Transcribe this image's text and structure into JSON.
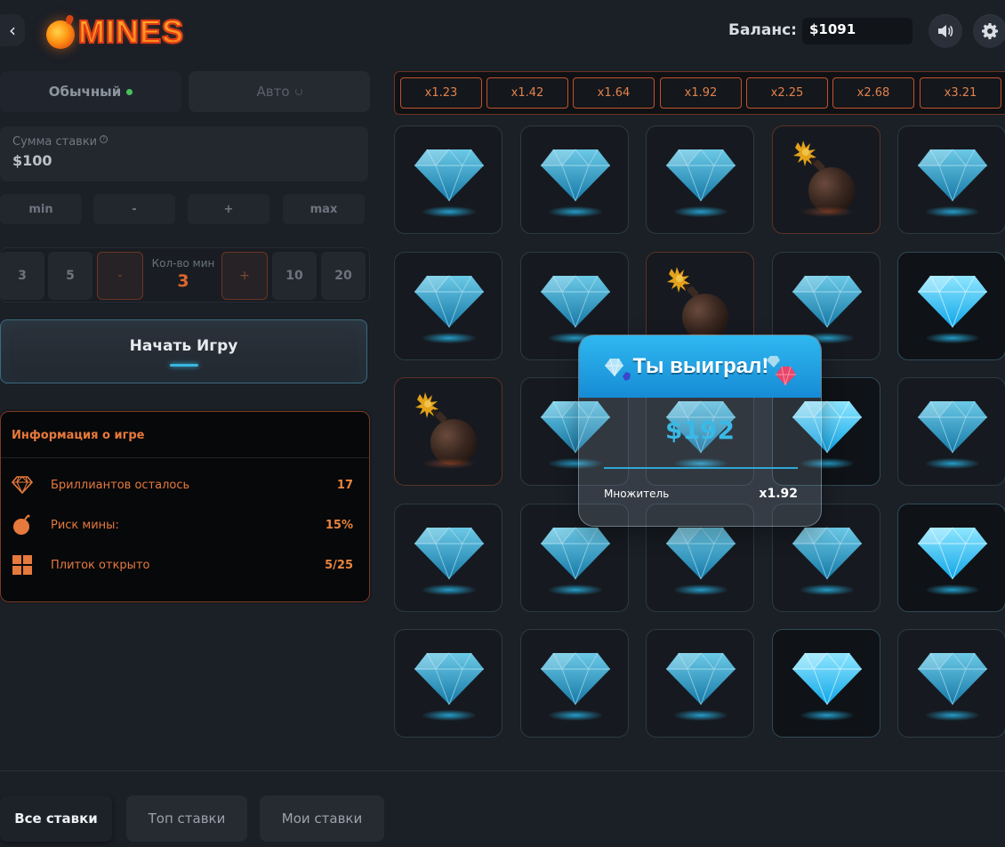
{
  "header": {
    "logo_text": "MINES",
    "balance_label": "Баланс:",
    "balance_value": "$1091"
  },
  "mode_tabs": [
    {
      "label": "Обычный",
      "active": true
    },
    {
      "label": "Авто",
      "active": false
    }
  ],
  "bet": {
    "label": "Сумма ставки",
    "value": "$100",
    "controls": [
      "min",
      "-",
      "+",
      "max"
    ]
  },
  "mines": {
    "options_left": [
      "3",
      "5"
    ],
    "decrement": "-",
    "count_label": "Кол-во мин",
    "count_value": "3",
    "increment": "+",
    "options_right": [
      "10",
      "20"
    ]
  },
  "start_button": {
    "label": "Начать Игру"
  },
  "info": {
    "title": "Информация о игре",
    "rows": [
      {
        "icon": "diamond-icon",
        "label": "Бриллиантов осталось",
        "value": "17"
      },
      {
        "icon": "bomb-icon",
        "label": "Риск мины:",
        "value": "15%"
      },
      {
        "icon": "grid-icon",
        "label": "Плиток открыто",
        "value": "5/25"
      }
    ]
  },
  "multipliers": [
    "x1.23",
    "x1.42",
    "x1.64",
    "x1.92",
    "x2.25",
    "x2.68",
    "x3.21"
  ],
  "grid": [
    [
      "gem",
      "gem",
      "gem",
      "bomb",
      "gem"
    ],
    [
      "gem",
      "gem",
      "bomb",
      "gem",
      "gem-bright"
    ],
    [
      "bomb",
      "gem",
      "gem",
      "gem-bright",
      "gem"
    ],
    [
      "gem",
      "gem",
      "gem",
      "gem",
      "gem-bright"
    ],
    [
      "gem",
      "gem",
      "gem",
      "gem-bright",
      "gem"
    ]
  ],
  "win_popup": {
    "title": "Ты выиграл!",
    "amount": "$192",
    "multiplier_label": "Множитель",
    "multiplier_value": "x1.92"
  },
  "bottom_tabs": [
    {
      "label": "Все ставки",
      "active": true
    },
    {
      "label": "Топ ставки",
      "active": false
    },
    {
      "label": "Мои ставки",
      "active": false
    }
  ],
  "colors": {
    "accent_orange": "#e0662d",
    "accent_blue": "#39b9e6",
    "background": "#1b1f26"
  }
}
